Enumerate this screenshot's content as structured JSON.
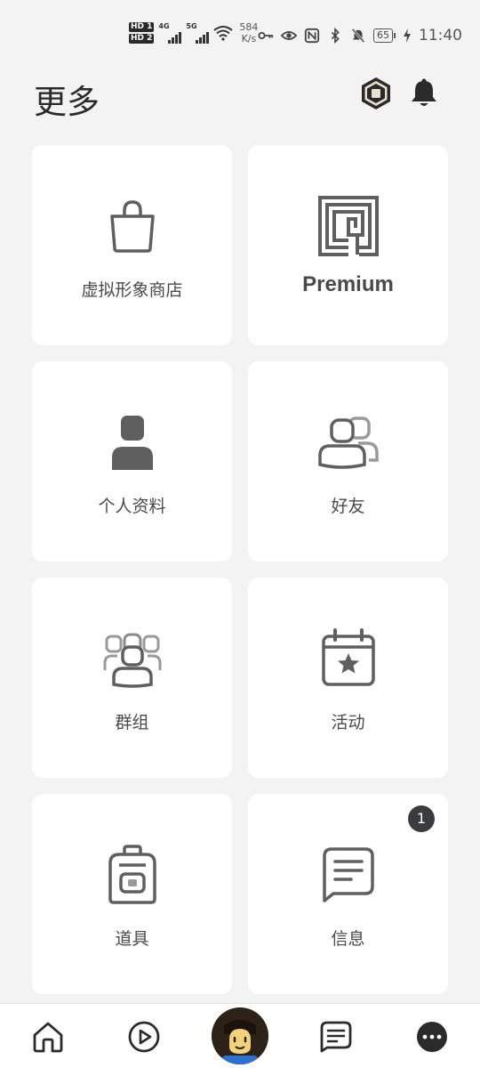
{
  "status_bar": {
    "hd1": "HD 1",
    "hd2": "HD 2",
    "net1": "4G",
    "net2": "5G",
    "speed_value": "584",
    "speed_unit": "K/s",
    "battery": "65",
    "time": "11:40"
  },
  "header": {
    "title": "更多",
    "robux_icon": "robux-icon",
    "bell_icon": "bell-icon"
  },
  "tiles": [
    {
      "label": "虚拟形象商店",
      "icon": "shopping-bag-icon"
    },
    {
      "label": "Premium",
      "icon": "premium-icon"
    },
    {
      "label": "个人资料",
      "icon": "profile-icon"
    },
    {
      "label": "好友",
      "icon": "friends-icon"
    },
    {
      "label": "群组",
      "icon": "groups-icon"
    },
    {
      "label": "活动",
      "icon": "calendar-star-icon"
    },
    {
      "label": "道具",
      "icon": "backpack-icon"
    },
    {
      "label": "信息",
      "icon": "message-icon",
      "badge": "1"
    }
  ],
  "bottom_nav": {
    "items": [
      "home-icon",
      "play-icon",
      "avatar",
      "chat-icon",
      "more-icon"
    ]
  },
  "colors": {
    "background": "#f3f3f4",
    "card": "#ffffff",
    "icon": "#5f5f5f",
    "badge": "#393b3d"
  }
}
